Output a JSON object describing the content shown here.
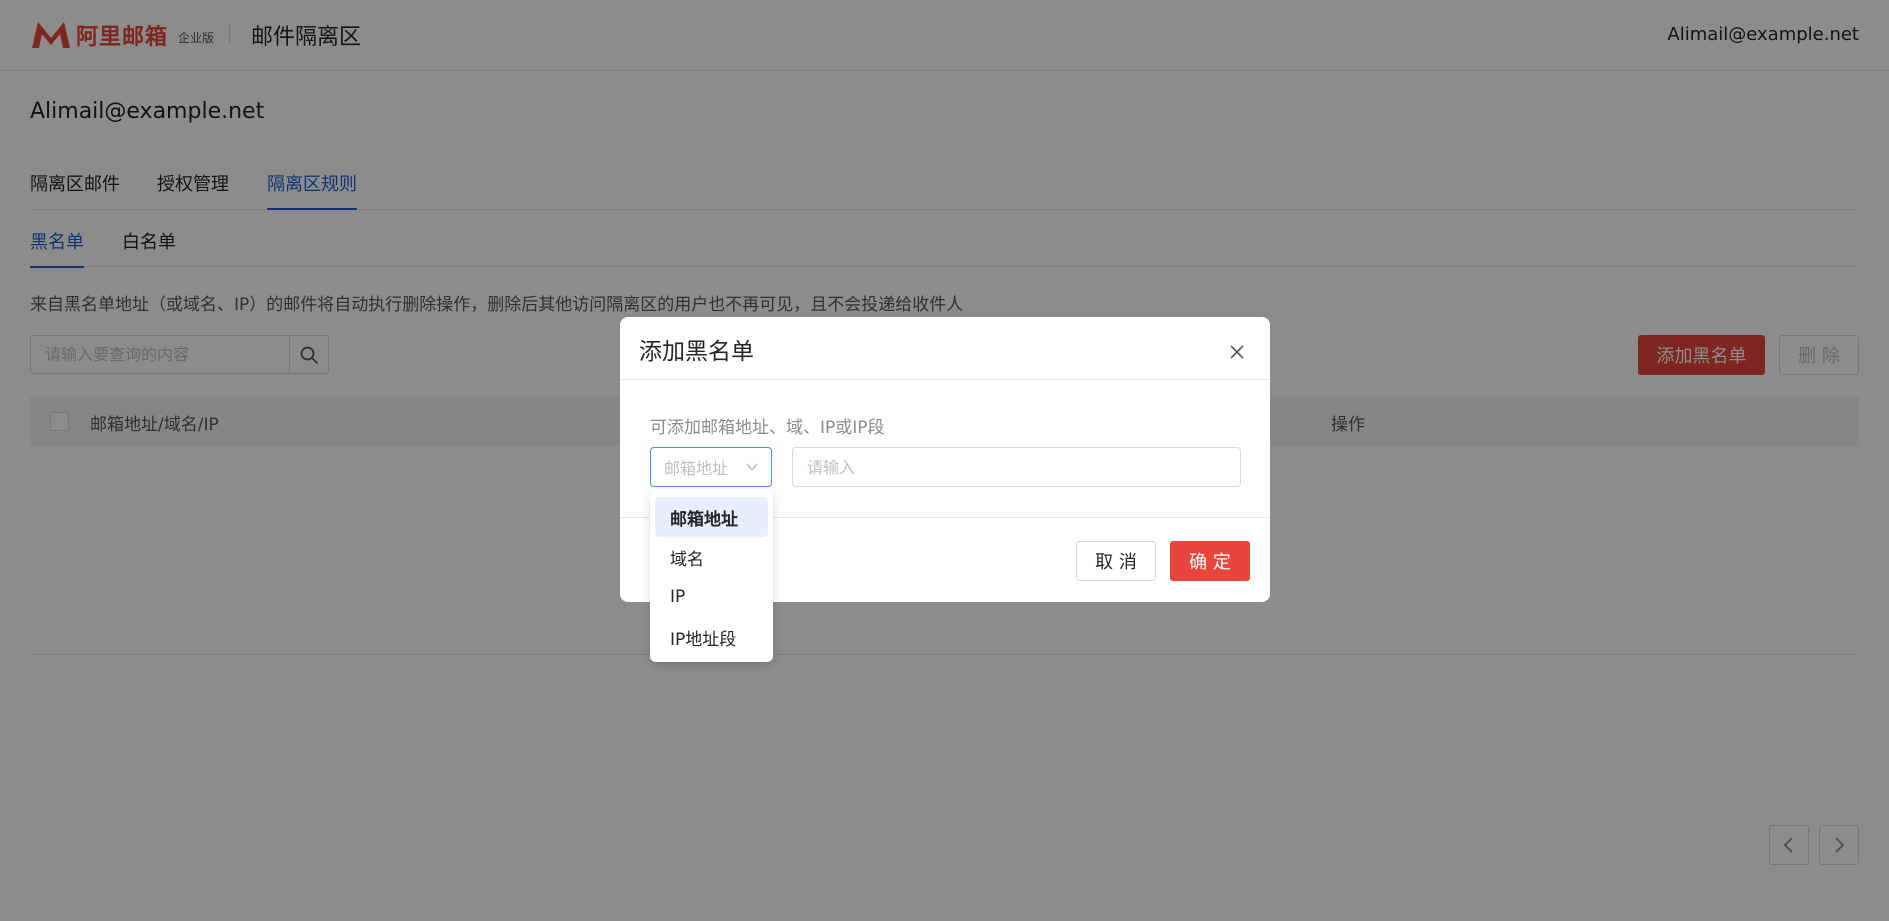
{
  "header": {
    "logo_text": "阿里邮箱",
    "logo_edition": "企业版",
    "title": "邮件隔离区",
    "user": "Alimail@example.net",
    "brand_color": "#e8463c"
  },
  "account": "Alimail@example.net",
  "tabs": [
    {
      "label": "隔离区邮件",
      "active": false
    },
    {
      "label": "授权管理",
      "active": false
    },
    {
      "label": "隔离区规则",
      "active": true
    }
  ],
  "subtabs": [
    {
      "label": "黑名单",
      "active": true
    },
    {
      "label": "白名单",
      "active": false
    }
  ],
  "notice": "来自黑名单地址（或域名、IP）的邮件将自动执行删除操作，删除后其他访问隔离区的用户也不再可见，且不会投递给收件人",
  "search": {
    "placeholder": "请输入要查询的内容",
    "value": "",
    "icon": "search-icon"
  },
  "toolbar": {
    "add_label": "添加黑名单",
    "delete_label": "删 除"
  },
  "table": {
    "columns": [
      "邮箱地址/域名/IP",
      "操作"
    ],
    "rows": []
  },
  "pagination": {
    "prev_icon": "chevron-left-icon",
    "next_icon": "chevron-right-icon"
  },
  "modal": {
    "title": "添加黑名单",
    "hint": "可添加邮箱地址、域、IP或IP段",
    "type_select": {
      "placeholder": "邮箱地址",
      "options": [
        "邮箱地址",
        "域名",
        "IP",
        "IP地址段"
      ],
      "highlighted": "邮箱地址"
    },
    "value_input": {
      "placeholder": "请输入",
      "value": ""
    },
    "cancel_label": "取 消",
    "ok_label": "确 定"
  },
  "colors": {
    "accent": "#1f5fd6",
    "danger": "#e8463c"
  }
}
